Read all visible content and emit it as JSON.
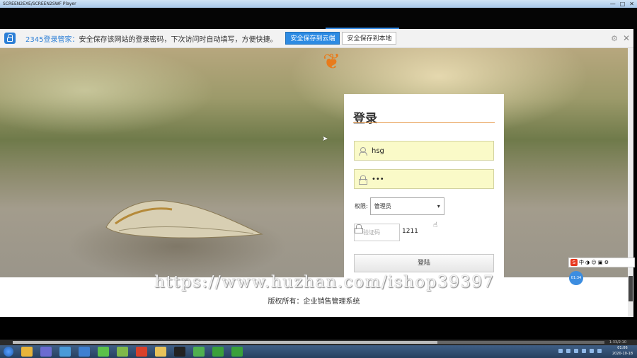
{
  "window": {
    "title": "SCREEN2EXE/SCREEN2SWF Player",
    "controls": [
      "—",
      "□",
      "✕"
    ]
  },
  "notification": {
    "brand": "2345登录管家：",
    "message": "安全保存该网站的登录密码，下次访问时自动填写，方便快捷。",
    "cloud_button": "安全保存到云端",
    "local_button": "安全保存到本地",
    "settings_icon": "gear-icon",
    "close_icon": "close-icon"
  },
  "login": {
    "title": "登录",
    "username_value": "hsg",
    "password_value": "•••",
    "permission_label": "权限:",
    "permission_selected": "管理员",
    "captcha_placeholder": "验证码",
    "captcha_code": "1211",
    "submit_label": "登陆"
  },
  "footer": {
    "copyright": "版权所有：企业销售管理系统"
  },
  "watermark": "https://www.huzhan.com/ishop39397",
  "ime": {
    "label": "中",
    "timer": "01:34"
  },
  "player": {
    "time": "1:33/2:10"
  },
  "taskbar": {
    "time": "01:06",
    "date": "2020-10-18"
  },
  "colors": {
    "accent": "#2d8be3",
    "field_bg": "#fafac8",
    "rule": "#e8a15a"
  }
}
